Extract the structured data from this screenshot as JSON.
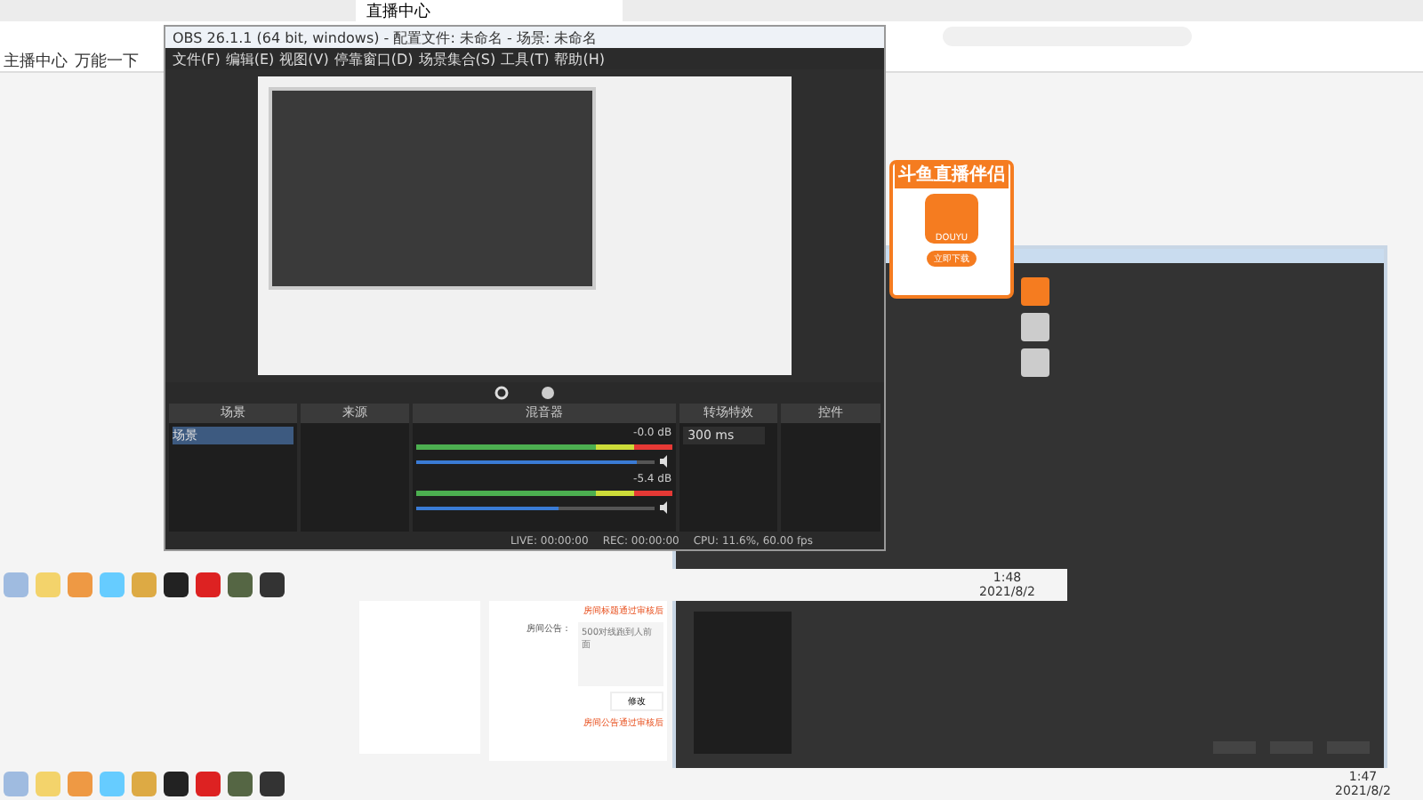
{
  "browser": {
    "tab": "直播中心",
    "bookmarks": [
      "主播中心",
      "万能一下"
    ]
  },
  "obs": {
    "title": "OBS 26.1.1 (64 bit, windows) - 配置文件: 未命名 - 场景: 未命名",
    "menu": [
      "文件(F)",
      "编辑(E)",
      "视图(V)",
      "停靠窗口(D)",
      "场景集合(S)",
      "工具(T)",
      "帮助(H)"
    ],
    "docks": {
      "scenes": {
        "header": "场景",
        "items": [
          {
            "label": "场景",
            "selected": true
          }
        ]
      },
      "sources": {
        "header": "来源"
      },
      "mixer": {
        "header": "混音器",
        "channels": [
          {
            "reading": "-0.0 dB",
            "level": 0.93,
            "muted": false
          },
          {
            "reading": "-5.4 dB",
            "level": 0.6,
            "muted": false
          }
        ]
      },
      "transitions": {
        "header": "转场特效",
        "duration": "300 ms"
      },
      "controls": {
        "header": "控件"
      }
    },
    "status": [
      "LIVE: 00:00:00",
      "REC: 00:00:00",
      "CPU: 11.6%, 60.00 fps"
    ]
  },
  "ad": {
    "title": "斗鱼直播伴侣",
    "logo": "DOUYU",
    "button": "立即下载"
  },
  "inner_clock": {
    "time": "1:48",
    "date": "2021/8/2"
  },
  "room": {
    "notice_top": "房间标题通过审核后",
    "label": "房间公告：",
    "value": "500对线跑到人前面",
    "button": "修改",
    "notice_bottom": "房间公告通过审核后"
  },
  "clock": {
    "time": "1:47",
    "date": "2021/8/2"
  }
}
